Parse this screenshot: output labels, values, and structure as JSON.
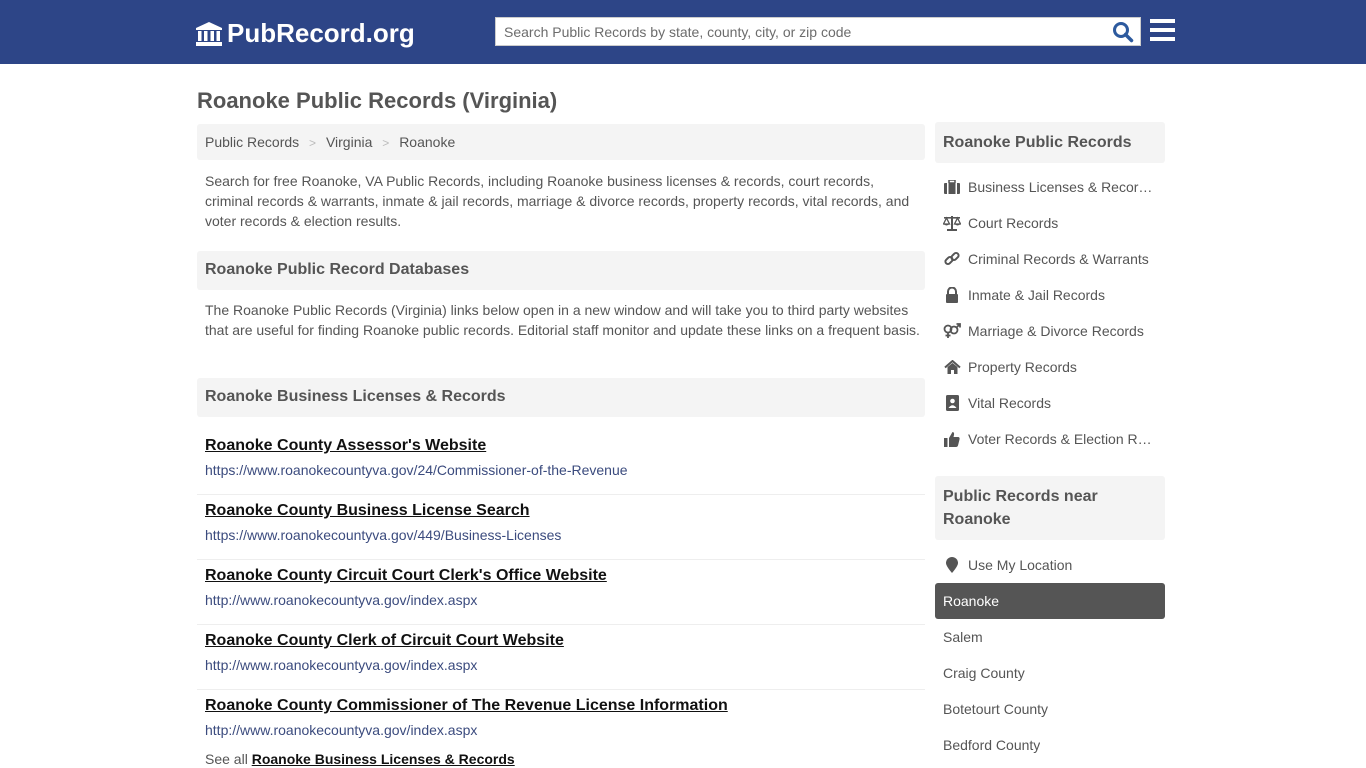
{
  "header": {
    "logo_text": "PubRecord.org",
    "search_placeholder": "Search Public Records by state, county, city, or zip code",
    "search_value": "",
    "brand_color": "#2d4587"
  },
  "page": {
    "title": "Roanoke Public Records (Virginia)"
  },
  "breadcrumb": [
    {
      "label": "Public Records"
    },
    {
      "label": "Virginia"
    },
    {
      "label": "Roanoke"
    }
  ],
  "breadcrumb_separator": ">",
  "intro": "Search for free Roanoke, VA Public Records, including Roanoke business licenses & records, court records, criminal records & warrants, inmate & jail records, marriage & divorce records, property records, vital records, and voter records & election results.",
  "databases": {
    "heading": "Roanoke Public Record Databases",
    "description": "The Roanoke Public Records (Virginia) links below open in a new window and will take you to third party websites that are useful for finding Roanoke public records. Editorial staff monitor and update these links on a frequent basis."
  },
  "business": {
    "heading": "Roanoke Business Licenses & Records",
    "records": [
      {
        "title": "Roanoke County Assessor's Website",
        "url": "https://www.roanokecountyva.gov/24/Commissioner-of-the-Revenue"
      },
      {
        "title": "Roanoke County Business License Search",
        "url": "https://www.roanokecountyva.gov/449/Business-Licenses"
      },
      {
        "title": "Roanoke County Circuit Court Clerk's Office Website",
        "url": "http://www.roanokecountyva.gov/index.aspx"
      },
      {
        "title": "Roanoke County Clerk of Circuit Court Website",
        "url": "http://www.roanokecountyva.gov/index.aspx"
      },
      {
        "title": "Roanoke County Commissioner of The Revenue License Information",
        "url": "http://www.roanokecountyva.gov/index.aspx"
      }
    ],
    "see_all_prefix": "See all",
    "see_all_link": "Roanoke Business Licenses & Records"
  },
  "sidebar": {
    "records_heading": "Roanoke Public Records",
    "categories": [
      {
        "label": "Business Licenses & Records",
        "icon": "briefcase-icon"
      },
      {
        "label": "Court Records",
        "icon": "balance-scale-icon"
      },
      {
        "label": "Criminal Records & Warrants",
        "icon": "link-icon"
      },
      {
        "label": "Inmate & Jail Records",
        "icon": "lock-icon"
      },
      {
        "label": "Marriage & Divorce Records",
        "icon": "venus-mars-icon"
      },
      {
        "label": "Property Records",
        "icon": "home-icon"
      },
      {
        "label": "Vital Records",
        "icon": "address-book-icon"
      },
      {
        "label": "Voter Records & Election Results",
        "icon": "thumbs-up-icon"
      }
    ],
    "nearby_heading": "Public Records near Roanoke",
    "use_location": "Use My Location",
    "nearby": [
      {
        "label": "Roanoke",
        "active": true
      },
      {
        "label": "Salem",
        "active": false
      },
      {
        "label": "Craig County",
        "active": false
      },
      {
        "label": "Botetourt County",
        "active": false
      },
      {
        "label": "Bedford County",
        "active": false
      }
    ]
  }
}
